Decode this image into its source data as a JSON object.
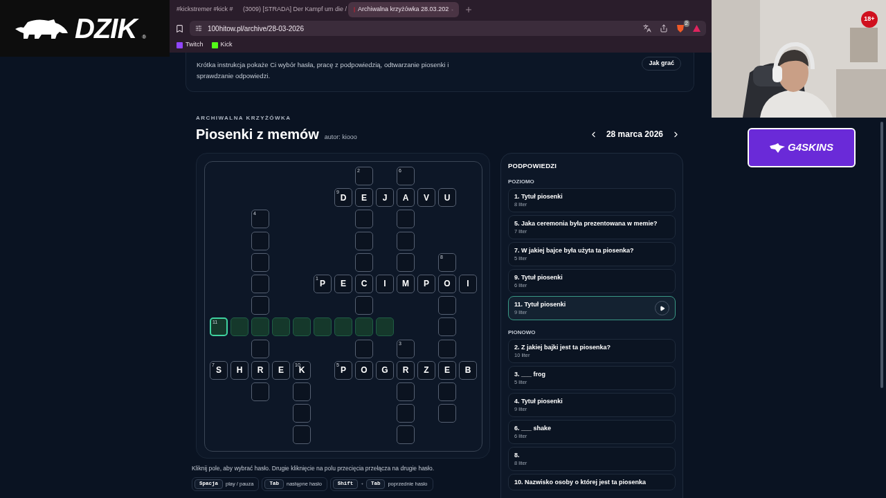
{
  "logo": {
    "text": "DZIK",
    "mark": "®"
  },
  "browser": {
    "tabs": [
      {
        "title": "#kickstremer #kick #",
        "kind": "plain",
        "selected": false
      },
      {
        "title": "(3009) [STRADA] Der Kampf um die /",
        "kind": "video",
        "selected": false
      },
      {
        "title": "Archiwalna krzyżówka 28.03.202",
        "kind": "plain",
        "selected": true
      }
    ],
    "address": "100hitow.pl/archive/28-03-2026",
    "extension_badge": "2",
    "bookmarks": [
      {
        "label": "Twitch",
        "kind": "twitch"
      },
      {
        "label": "Kick",
        "kind": "kick"
      }
    ]
  },
  "intro": {
    "text": "Krótka instrukcja pokaże Ci wybór hasła, pracę z podpowiedzią, odtwarzanie piosenki i sprawdzanie odpowiedzi.",
    "button": "Jak grać"
  },
  "puzzle": {
    "eyebrow": "ARCHIWALNA KRZYŻÓWKA",
    "title": "Piosenki z memów",
    "author": "autor: kiooo",
    "date": "28 marca 2026",
    "rows": [
      [
        null,
        null,
        null,
        null,
        null,
        null,
        null,
        {
          "number": "2",
          "highlighted": false,
          "selected": false
        },
        null,
        {
          "number": "6",
          "highlighted": false,
          "selected": false
        },
        null,
        null,
        null
      ],
      [
        null,
        null,
        null,
        null,
        null,
        null,
        {
          "letter": "D",
          "number": "9",
          "highlighted": false,
          "selected": false
        },
        {
          "letter": "E",
          "highlighted": false,
          "selected": false
        },
        {
          "letter": "J",
          "highlighted": false,
          "selected": false
        },
        {
          "letter": "A",
          "highlighted": false,
          "selected": false
        },
        {
          "letter": "V",
          "highlighted": false,
          "selected": false
        },
        {
          "letter": "U",
          "highlighted": false,
          "selected": false
        },
        null
      ],
      [
        null,
        null,
        {
          "number": "4",
          "highlighted": false,
          "selected": false
        },
        null,
        null,
        null,
        null,
        {
          "highlighted": false,
          "selected": false
        },
        null,
        {
          "highlighted": false,
          "selected": false
        },
        null,
        null,
        null
      ],
      [
        null,
        null,
        {
          "highlighted": false,
          "selected": false
        },
        null,
        null,
        null,
        null,
        {
          "highlighted": false,
          "selected": false
        },
        null,
        {
          "highlighted": false,
          "selected": false
        },
        null,
        null,
        null
      ],
      [
        null,
        null,
        {
          "highlighted": false,
          "selected": false
        },
        null,
        null,
        null,
        null,
        {
          "highlighted": false,
          "selected": false
        },
        null,
        {
          "highlighted": false,
          "selected": false
        },
        null,
        {
          "number": "8",
          "highlighted": false,
          "selected": false
        },
        null
      ],
      [
        null,
        null,
        {
          "highlighted": false,
          "selected": false
        },
        null,
        null,
        {
          "letter": "P",
          "number": "1",
          "highlighted": false,
          "selected": false
        },
        {
          "letter": "E",
          "highlighted": false,
          "selected": false
        },
        {
          "letter": "C",
          "highlighted": false,
          "selected": false
        },
        {
          "letter": "I",
          "highlighted": false,
          "selected": false
        },
        {
          "letter": "M",
          "highlighted": false,
          "selected": false
        },
        {
          "letter": "P",
          "highlighted": false,
          "selected": false
        },
        {
          "letter": "O",
          "highlighted": false,
          "selected": false
        },
        {
          "letter": "I",
          "highlighted": false,
          "selected": false
        }
      ],
      [
        null,
        null,
        {
          "highlighted": false,
          "selected": false
        },
        null,
        null,
        null,
        null,
        {
          "highlighted": false,
          "selected": false
        },
        null,
        null,
        null,
        {
          "highlighted": false,
          "selected": false
        },
        null
      ],
      [
        {
          "number": "11",
          "highlighted": true,
          "selected": true
        },
        {
          "highlighted": true,
          "selected": false
        },
        {
          "highlighted": true,
          "selected": false
        },
        {
          "highlighted": true,
          "selected": false
        },
        {
          "highlighted": true,
          "selected": false
        },
        {
          "highlighted": true,
          "selected": false
        },
        {
          "highlighted": true,
          "selected": false
        },
        {
          "highlighted": true,
          "selected": false
        },
        {
          "highlighted": true,
          "selected": false
        },
        null,
        null,
        {
          "highlighted": false,
          "selected": false
        },
        null
      ],
      [
        null,
        null,
        {
          "highlighted": false,
          "selected": false
        },
        null,
        null,
        null,
        null,
        {
          "highlighted": false,
          "selected": false
        },
        null,
        {
          "number": "3",
          "highlighted": false,
          "selected": false
        },
        null,
        {
          "highlighted": false,
          "selected": false
        },
        null
      ],
      [
        {
          "letter": "S",
          "number": "7",
          "highlighted": false,
          "selected": false
        },
        {
          "letter": "H",
          "highlighted": false,
          "selected": false
        },
        {
          "letter": "R",
          "highlighted": false,
          "selected": false
        },
        {
          "letter": "E",
          "highlighted": false,
          "selected": false
        },
        {
          "letter": "K",
          "number": "10",
          "highlighted": false,
          "selected": false
        },
        null,
        {
          "letter": "P",
          "number": "5",
          "highlighted": false,
          "selected": false
        },
        {
          "letter": "O",
          "highlighted": false,
          "selected": false
        },
        {
          "letter": "G",
          "highlighted": false,
          "selected": false
        },
        {
          "letter": "R",
          "highlighted": false,
          "selected": false
        },
        {
          "letter": "Z",
          "highlighted": false,
          "selected": false
        },
        {
          "letter": "E",
          "highlighted": false,
          "selected": false
        },
        {
          "letter": "B",
          "highlighted": false,
          "selected": false
        }
      ],
      [
        null,
        null,
        {
          "highlighted": false,
          "selected": false
        },
        null,
        {
          "highlighted": false,
          "selected": false
        },
        null,
        null,
        null,
        null,
        {
          "highlighted": false,
          "selected": false
        },
        null,
        {
          "highlighted": false,
          "selected": false
        },
        null
      ],
      [
        null,
        null,
        null,
        null,
        {
          "highlighted": false,
          "selected": false
        },
        null,
        null,
        null,
        null,
        {
          "highlighted": false,
          "selected": false
        },
        null,
        {
          "highlighted": false,
          "selected": false
        },
        null
      ],
      [
        null,
        null,
        null,
        null,
        {
          "highlighted": false,
          "selected": false
        },
        null,
        null,
        null,
        null,
        {
          "highlighted": false,
          "selected": false
        },
        null,
        null,
        null
      ]
    ],
    "instruction": "Kliknij pole, aby wybrać hasło. Drugie kliknięcie na polu przecięcia przełącza na drugie hasło.",
    "shortcuts": [
      {
        "keys": [
          "Spacja"
        ],
        "action": "play / pauza"
      },
      {
        "keys": [
          "Tab"
        ],
        "action": "następne hasło"
      },
      {
        "keys": [
          "Shift",
          "Tab"
        ],
        "joiner": "+",
        "action": "poprzednie hasło"
      }
    ]
  },
  "hints": {
    "title": "PODPOWIEDZI",
    "sections": [
      {
        "title": "POZIOMO",
        "clues": [
          {
            "label": "1. Tytuł piosenki",
            "length": "8 liter",
            "selected": false
          },
          {
            "label": "5. Jaka ceremonia była prezentowana w memie?",
            "length": "7 liter",
            "selected": false
          },
          {
            "label": "7. W jakiej bajce była użyta ta piosenka?",
            "length": "5 liter",
            "selected": false
          },
          {
            "label": "9. Tytuł piosenki",
            "length": "6 liter",
            "selected": false
          },
          {
            "label": "11. Tytuł piosenki",
            "length": "9 liter",
            "selected": true
          }
        ]
      },
      {
        "title": "PIONOWO",
        "clues": [
          {
            "label": "2. Z jakiej bajki jest ta piosenka?",
            "length": "10 liter",
            "selected": false
          },
          {
            "label": "3. ___ frog",
            "length": "5 liter",
            "selected": false
          },
          {
            "label": "4. Tytuł piosenki",
            "length": "9 liter",
            "selected": false
          },
          {
            "label": "6. ___ shake",
            "length": "6 liter",
            "selected": false
          },
          {
            "label": "8.",
            "length": "8 liter",
            "selected": false
          },
          {
            "label": "10. Nazwisko osoby o której jest ta piosenka",
            "selected": false
          }
        ]
      }
    ]
  },
  "sponsor": {
    "text": "G4SKINS"
  },
  "age_badge": "18+"
}
